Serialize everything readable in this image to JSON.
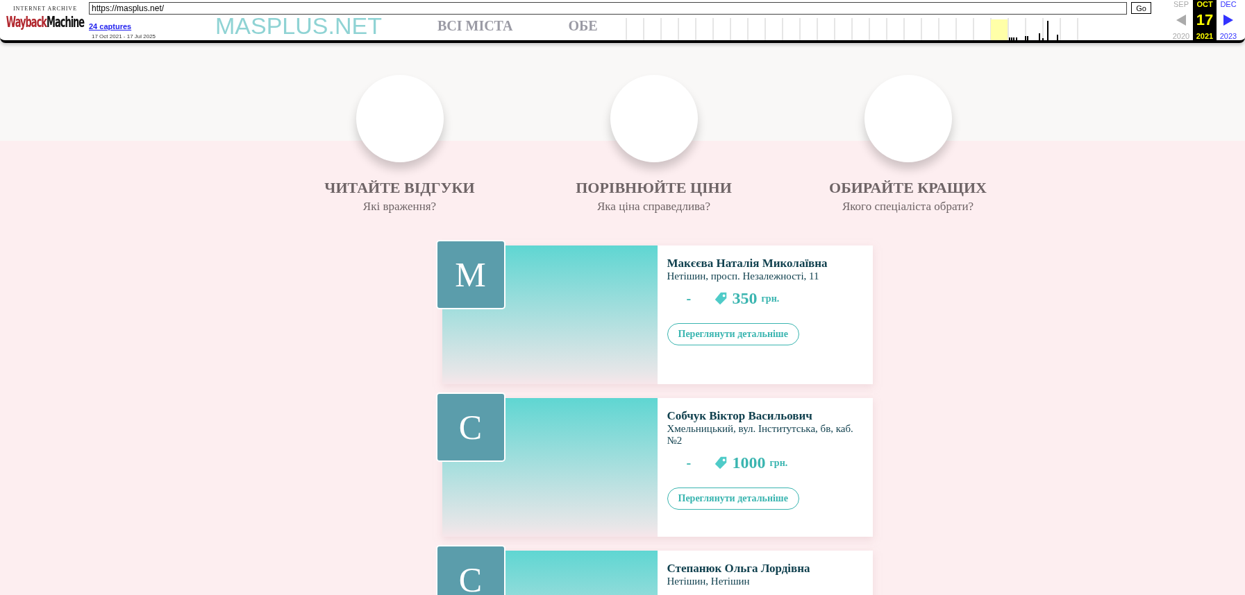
{
  "wayback": {
    "logo_top": "INTERNET ARCHIVE",
    "logo_left": "Wayback",
    "logo_right": "Machine",
    "url": "https://masplus.net/",
    "go": "Go",
    "captures": "24 captures",
    "range": "17 Oct 2021 - 17 Jul 2025",
    "months": [
      {
        "label": "SEP",
        "year": "2020",
        "selected": false,
        "available": false
      },
      {
        "label": "OCT",
        "day": "17",
        "year": "2021",
        "selected": true,
        "available": true
      },
      {
        "label": "DEC",
        "year": "2023",
        "selected": false,
        "available": true
      }
    ]
  },
  "background_site": {
    "brand_left": "MASPLUS",
    "brand_right": ".NET",
    "nav": [
      "ВСІ МІСТА",
      "ОБЕ"
    ]
  },
  "features": [
    {
      "title": "ЧИТАЙТЕ ВІДГУКИ",
      "subtitle": "Які враження?"
    },
    {
      "title": "ПОРІВНЮЙТЕ ЦІНИ",
      "subtitle": "Яка ціна справедлива?"
    },
    {
      "title": "ОБИРАЙТЕ КРАЩИХ",
      "subtitle": "Якого спеціаліста обрати?"
    }
  ],
  "doctors": [
    {
      "initial": "М",
      "name": "Макєєва Наталія Миколаївна",
      "address": "Нетішин, просп. Незалежності, 11",
      "dash": "-",
      "price": "350",
      "currency": "грн.",
      "button": "Переглянути детальніше"
    },
    {
      "initial": "С",
      "name": "Собчук Віктор Васильович",
      "address": "Хмельницький, вул. Інститутська, бв, каб. №2",
      "dash": "-",
      "price": "1000",
      "currency": "грн.",
      "button": "Переглянути детальніше"
    },
    {
      "initial": "С",
      "name": "Степанюк Ольга Лордівна",
      "address": "Нетішин, Нетішин"
    }
  ]
}
